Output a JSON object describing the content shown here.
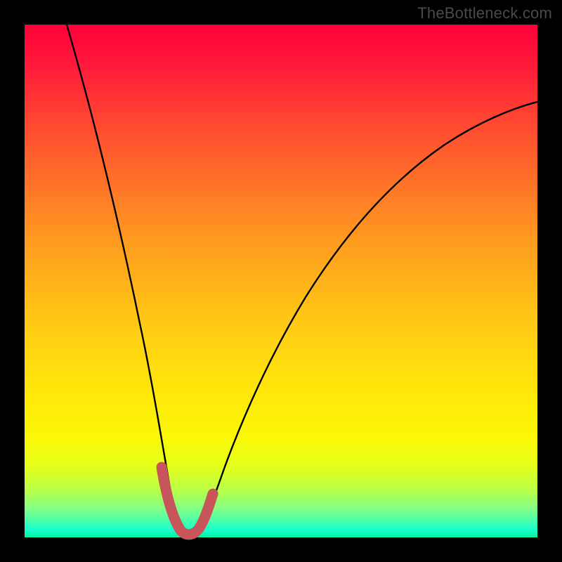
{
  "watermark": {
    "text": "TheBottleneck.com"
  },
  "chart_data": {
    "type": "line",
    "title": "",
    "xlabel": "",
    "ylabel": "",
    "xlim": [
      0,
      100
    ],
    "ylim": [
      0,
      100
    ],
    "series": [
      {
        "name": "bottleneck-curve",
        "x": [
          0,
          4.5,
          9.0,
          13.5,
          18.0,
          22.5,
          26.0,
          29.0,
          31.5,
          33.8,
          40.0,
          46.0,
          53.0,
          61.0,
          69.0,
          77.0,
          85.0,
          92.0,
          100.0
        ],
        "values": [
          100,
          84,
          68,
          52,
          37,
          23,
          11,
          3,
          0,
          2,
          16,
          29,
          41,
          52,
          60,
          67,
          72,
          76,
          80
        ]
      }
    ],
    "highlight": {
      "name": "bottleneck-highlight",
      "x": [
        24.2,
        25.3,
        26.3,
        27.3,
        28.3,
        29.3,
        30.3,
        31.3,
        32.2,
        33.1,
        34.0
      ],
      "values": [
        15.3,
        11.2,
        8.0,
        3.8,
        2.0,
        0.8,
        0.6,
        1.4,
        3.0,
        4.4,
        6.8
      ]
    },
    "background": "heat-gradient-vertical-red-to-green"
  }
}
